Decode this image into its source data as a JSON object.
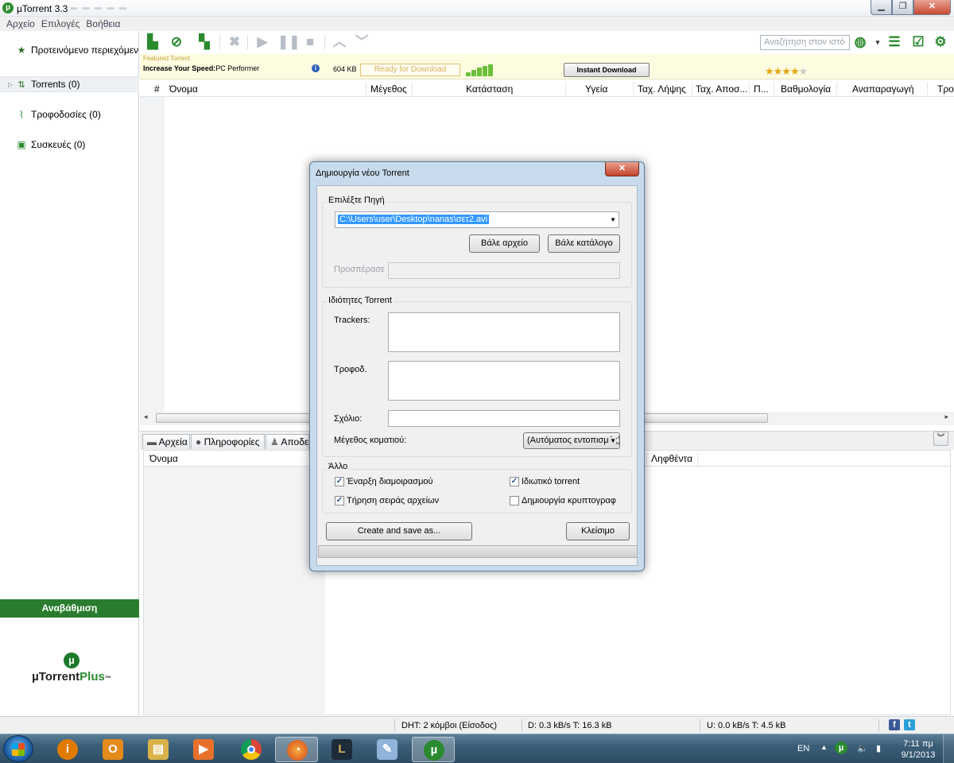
{
  "window": {
    "title": "µTorrent 3.3",
    "ghost_text": "▬ ▬ ▬ ▬ ▬"
  },
  "menu": [
    "Αρχείο",
    "Επιλογές",
    "Βοήθεια"
  ],
  "sidebar": {
    "items": [
      {
        "label": "Προτεινόμενο περιεχόμενο",
        "icon": "star-icon"
      },
      {
        "label": "Torrents (0)",
        "icon": "torrents-icon"
      },
      {
        "label": "Τροφοδοσίες (0)",
        "icon": "rss-icon"
      },
      {
        "label": "Συσκευές (0)",
        "icon": "device-icon"
      }
    ],
    "upgrade_label": "Αναβάθμιση",
    "logo_name": "µTorrent",
    "logo_suffix": "Plus",
    "logo_tm": "™"
  },
  "toolbar": {
    "search_placeholder": "Αναζήτηση στον ιστό"
  },
  "featured": {
    "label": "Featured Torrent",
    "title_bold": "Increase Your Speed:",
    "title_rest": "PC Performer",
    "size": "604 KB",
    "ready": "Ready for Download",
    "instant": "Instant Download",
    "rating": 4,
    "rating_max": 5
  },
  "list_columns": [
    "#",
    "Όνομα",
    "Μέγεθος",
    "Κατάσταση",
    "Υγεία",
    "Ταχ. Λήψης",
    "Ταχ. Αποσ...",
    "Π...",
    "Βαθμολογία",
    "Αναπαραγωγή",
    "Τρο"
  ],
  "bottom_tabs": [
    "Αρχεία",
    "Πληροφορίες",
    "Αποδε"
  ],
  "files_columns": [
    "Όνομα",
    "Ληφθέντα"
  ],
  "statusbar": {
    "dht": "DHT: 2 κόμβοι (Είσοδος)",
    "down": "D: 0.3 kB/s T: 16.3 kB",
    "up": "U: 0.0 kB/s T: 4.5 kB"
  },
  "dialog": {
    "title": "Δημιουργία νέου Torrent",
    "source_group": "Επιλέξτε Πηγή",
    "source_path": "C:\\Users\\user\\Desktop\\nanas\\σετ2.avi",
    "add_file": "Βάλε αρχείο",
    "add_folder": "Βάλε κατάλογο",
    "skip_label": "Προσπέρασε",
    "props_group": "Ιδιότητες Torrent",
    "trackers_label": "Trackers:",
    "feeds_label": "Τροφοδ.",
    "comment_label": "Σχόλιο:",
    "piece_label": "Μέγεθος κοματιού:",
    "piece_value": "(Αυτόματος εντοπισμός)",
    "other_group": "Άλλο",
    "cb_start_seed": "Έναρξη διαμοιρασμού",
    "cb_private": "Ιδιωτικό torrent",
    "cb_order": "Τήρηση σειράς αρχείων",
    "cb_encrypt": "Δημιουργία κρυπτογραφ",
    "create_btn": "Create and save as...",
    "close_btn": "Κλείσιμο",
    "checks": {
      "start_seed": true,
      "private": true,
      "order": true,
      "encrypt": false
    }
  },
  "taskbar": {
    "lang": "EN",
    "time": "7:11 πμ",
    "date": "9/1/2013"
  },
  "colors": {
    "accent_green": "#2a8a2e",
    "upgrade_bg": "#2a7d2e",
    "selection_blue": "#3399ff"
  }
}
